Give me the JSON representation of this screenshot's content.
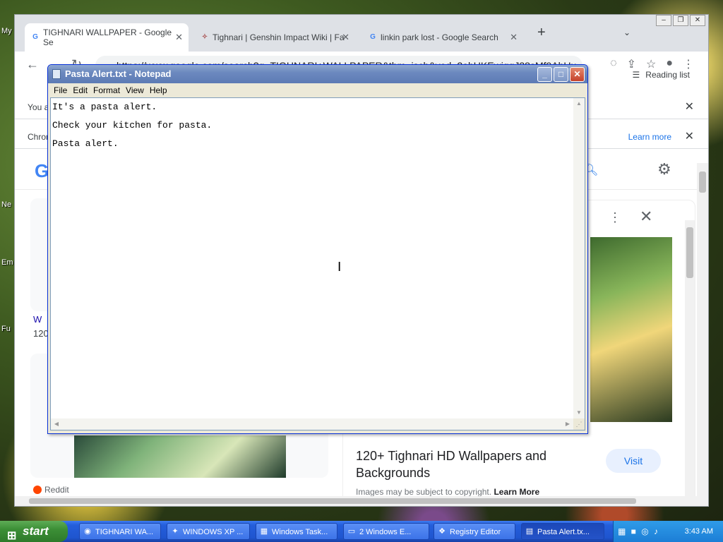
{
  "desktop": {
    "labels": [
      "My",
      "Ne",
      "Em",
      "Fu"
    ]
  },
  "chrome": {
    "tabs": [
      {
        "title": "TIGHNARI WALLPAPER - Google Se",
        "icon": "google-icon"
      },
      {
        "title": "Tighnari | Genshin Impact Wiki | Fa",
        "icon": "fandom-icon"
      },
      {
        "title": "linkin park lost - Google Search",
        "icon": "google-icon"
      }
    ],
    "url": "https://www.google.com/search?q=TIGHNARI+WALLPAPER&tbm=isch&ved=2ahUKEwiqgJ38sMf9AhUu...",
    "reading_list": "Reading list",
    "infobar1_text": "You a",
    "infobar2_text": "Chrom",
    "infobar2_link": "Learn more",
    "google_logo": "G",
    "left_meta": "W",
    "left_count": "120",
    "reddit": "Reddit",
    "panel": {
      "title": "120+ Tighnari HD Wallpapers and Backgrounds",
      "visit": "Visit",
      "copyright": "Images may be subject to copyright.",
      "learn_more": "Learn More"
    }
  },
  "notepad": {
    "title": "Pasta Alert.txt - Notepad",
    "menu": [
      "File",
      "Edit",
      "Format",
      "View",
      "Help"
    ],
    "lines": [
      "It's a pasta alert.",
      "Check your kitchen for pasta.",
      "Pasta alert."
    ]
  },
  "taskbar": {
    "start": "start",
    "buttons": [
      {
        "label": "TIGHNARI WA...",
        "icon": "chrome-icon"
      },
      {
        "label": "WINDOWS XP ...",
        "icon": "tool-icon"
      },
      {
        "label": "Windows Task...",
        "icon": "taskmgr-icon"
      },
      {
        "label": "2 Windows E...",
        "icon": "folder-icon"
      },
      {
        "label": "Registry Editor",
        "icon": "registry-icon"
      },
      {
        "label": "Pasta Alert.tx...",
        "icon": "notepad-icon"
      }
    ],
    "clock": "3:43 AM"
  }
}
